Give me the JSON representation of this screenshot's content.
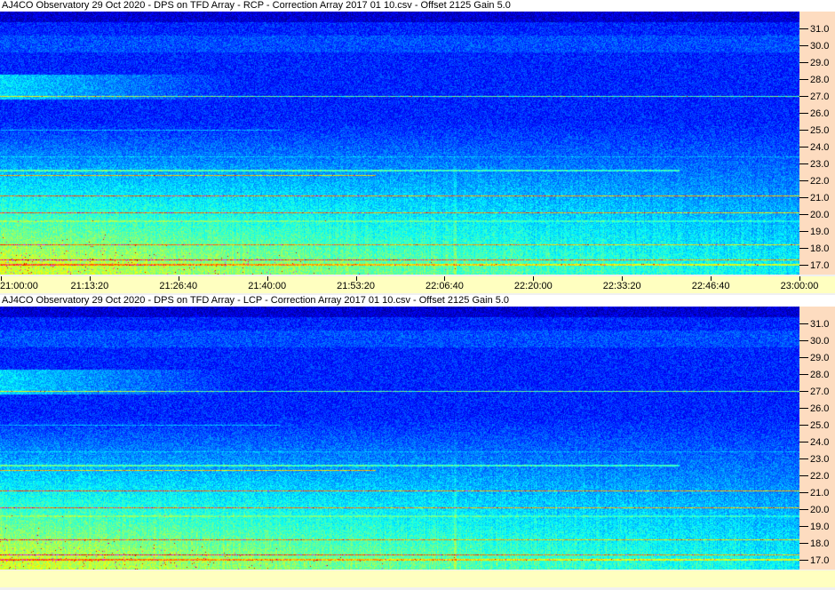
{
  "chart_data": [
    {
      "type": "heatmap",
      "title": "AJ4CO Observatory 29 Oct 2020  -  DPS on TFD Array  -  RCP  -  Correction Array 2017 01 10.csv  -  Offset 2125  Gain 5.0",
      "polarization": "RCP",
      "x_ticks": [
        "21:00:00",
        "21:13:20",
        "21:26:40",
        "21:40:00",
        "21:53:20",
        "22:06:40",
        "22:20:00",
        "22:33:20",
        "22:46:40",
        "23:00:00"
      ],
      "x_range": [
        "21:00:00",
        "23:00:00"
      ],
      "y_ticks": [
        "17.0",
        "18.0",
        "19.0",
        "20.0",
        "21.0",
        "22.0",
        "23.0",
        "24.0",
        "25.0",
        "26.0",
        "27.0",
        "28.0",
        "29.0",
        "30.0",
        "31.0"
      ],
      "y_range": [
        16.4,
        32.0
      ],
      "y_axis_position": "right",
      "colormap": "jet",
      "seed": 7
    },
    {
      "type": "heatmap",
      "title": "AJ4CO Observatory 29 Oct 2020  -  DPS on TFD Array  -  LCP  -  Correction Array 2017 01 10.csv  -  Offset 2125  Gain 5.0",
      "polarization": "LCP",
      "x_ticks": [],
      "x_range": [
        "21:00:00",
        "23:00:00"
      ],
      "y_ticks": [
        "17.0",
        "18.0",
        "19.0",
        "20.0",
        "21.0",
        "22.0",
        "23.0",
        "24.0",
        "25.0",
        "26.0",
        "27.0",
        "28.0",
        "29.0",
        "30.0",
        "31.0"
      ],
      "y_range": [
        16.4,
        32.0
      ],
      "y_axis_position": "right",
      "colormap": "jet",
      "seed": 13
    }
  ],
  "colors": {
    "freq_axis_bg": "#fddcc0",
    "time_axis_bg": "#ffffc0"
  }
}
